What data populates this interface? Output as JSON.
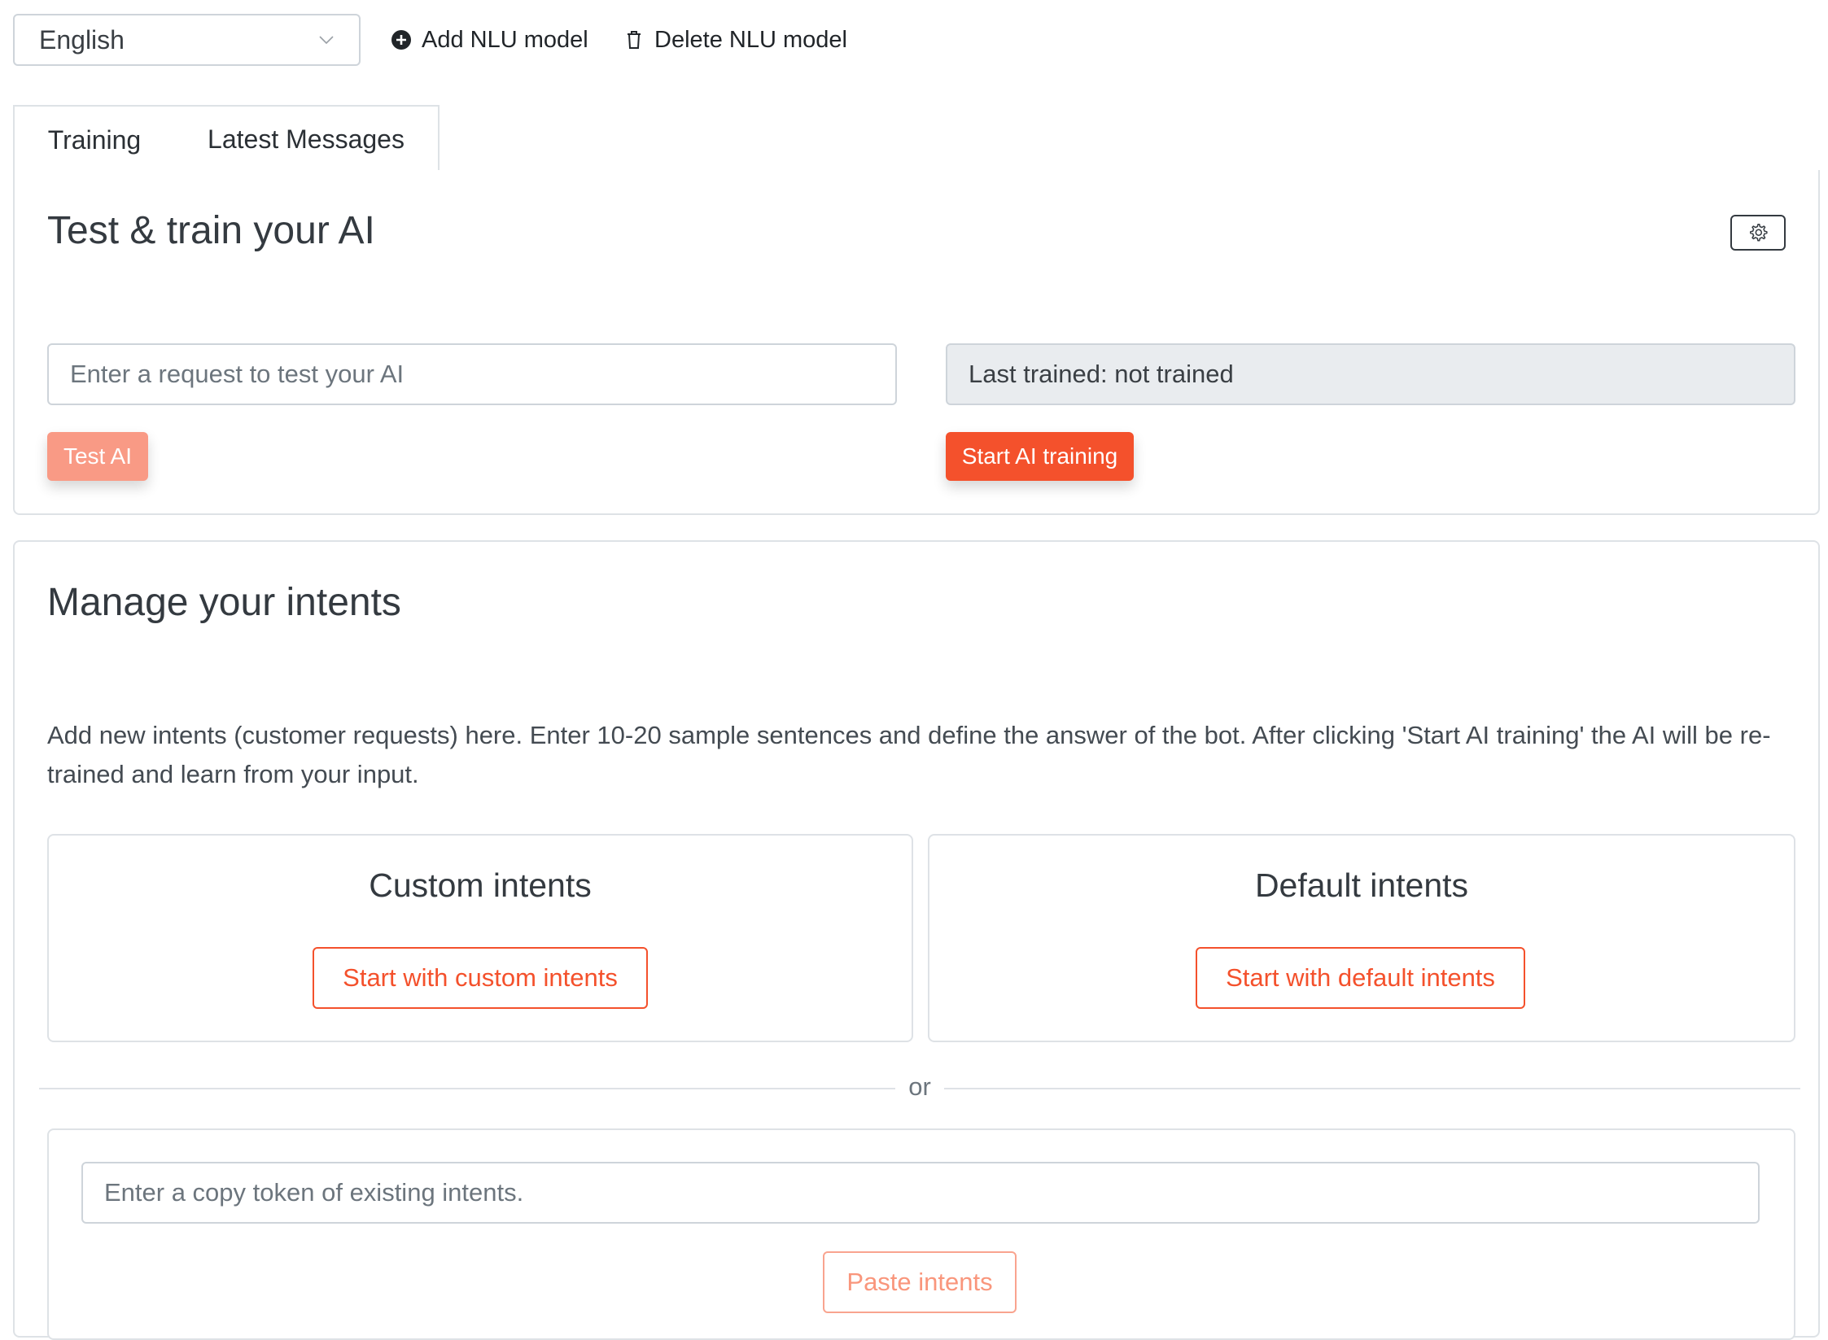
{
  "toolbar": {
    "language": "English",
    "add_model": "Add NLU model",
    "delete_model": "Delete NLU model"
  },
  "tabs": [
    {
      "label": "Training",
      "active": true
    },
    {
      "label": "Latest Messages",
      "active": false
    }
  ],
  "test_card": {
    "title": "Test & train your AI",
    "test_input_placeholder": "Enter a request to test your AI",
    "test_button": "Test AI",
    "last_trained": "Last trained: not trained",
    "train_button": "Start AI training"
  },
  "intents_card": {
    "title": "Manage your intents",
    "description": "Add new intents (customer requests) here. Enter 10-20 sample sentences and define the answer of the bot. After clicking 'Start AI training' the AI will be re-trained and learn from your input.",
    "custom": {
      "title": "Custom intents",
      "button": "Start with custom intents"
    },
    "default": {
      "title": "Default intents",
      "button": "Start with default intents"
    },
    "or_label": "or",
    "token_placeholder": "Enter a copy token of existing intents.",
    "paste_button": "Paste intents"
  },
  "colors": {
    "accent": "#f4512c",
    "accent_light": "#f99a85",
    "border": "#dee2e6",
    "input_disabled_bg": "#e9ecef"
  },
  "icons": {
    "language_dropdown": "chevron-down-icon",
    "add_model": "plus-circle-icon",
    "delete_model": "trash-icon",
    "settings": "gear-icon"
  }
}
